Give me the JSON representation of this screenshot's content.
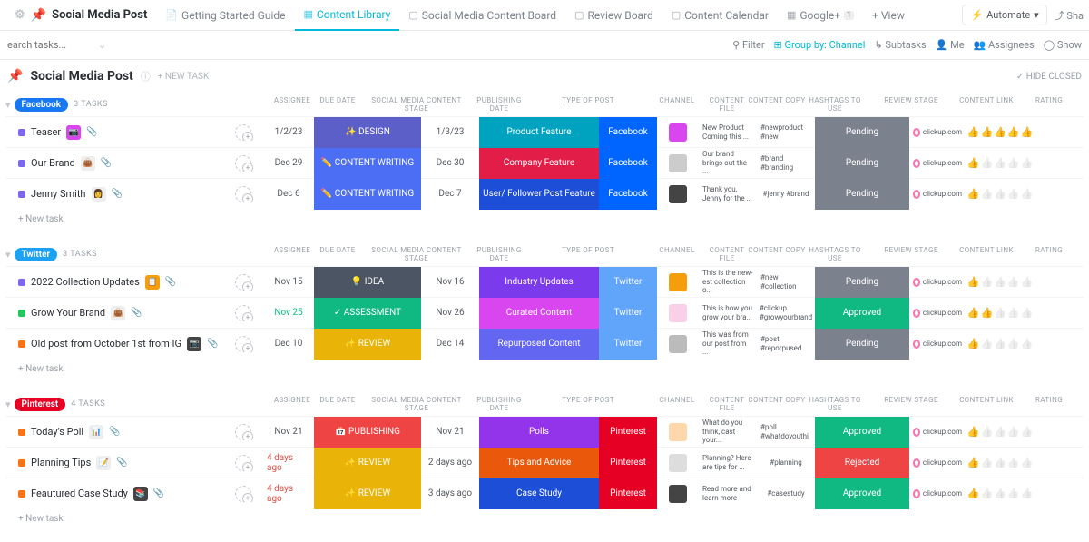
{
  "header": {
    "title": "Social Media Post",
    "views": [
      {
        "label": "Getting Started Guide",
        "icon": "📄"
      },
      {
        "label": "Content Library",
        "icon": "▦",
        "active": true
      },
      {
        "label": "Social Media Content Board",
        "icon": "▢"
      },
      {
        "label": "Review Board",
        "icon": "▢"
      },
      {
        "label": "Content Calendar",
        "icon": "▢"
      },
      {
        "label": "Google+",
        "icon": "▦",
        "badge": "1"
      }
    ],
    "add_view": "+ View",
    "automate": "Automate",
    "share": "Sha"
  },
  "toolbar": {
    "search_placeholder": "earch tasks...",
    "filter": "Filter",
    "group": "Group by: Channel",
    "subtasks": "Subtasks",
    "me": "Me",
    "assignees": "Assignees",
    "show": "Show"
  },
  "subheader": {
    "title": "Social Media Post",
    "newtask": "+ NEW TASK",
    "hide": "✓ HIDE CLOSED"
  },
  "columns": [
    "ASSIGNEE",
    "DUE DATE",
    "SOCIAL MEDIA CONTENT STAGE",
    "PUBLISHING DATE",
    "TYPE OF POST",
    "CHANNEL",
    "CONTENT FILE",
    "CONTENT COPY",
    "HASHTAGS TO USE",
    "REVIEW STAGE",
    "CONTENT LINK",
    "RATING"
  ],
  "newtask_row": "+ New task",
  "groups": [
    {
      "name": "Facebook",
      "count": "3 TASKS",
      "chip": "#1877f2",
      "bullet": "#7b68ee",
      "tasks": [
        {
          "title": "Teaser",
          "badge_bg": "#d946ef",
          "badge": "📷",
          "due": "1/2/23",
          "stage": "✨ DESIGN",
          "stage_bg": "#5b5fc7",
          "pub": "1/3/23",
          "type": "Product Feature",
          "type_bg": "#00a3bf",
          "chan": "Facebook",
          "chan_bg": "#0065ff",
          "file_bg": "#d946ef",
          "copy": "New Product Coming this ...",
          "hash": "#newproduct #new",
          "rev": "Pending",
          "rev_bg": "#7c828d",
          "link": "clickup.com",
          "rating": 5
        },
        {
          "title": "Our Brand",
          "badge_bg": "#eee",
          "badge": "👜",
          "due": "Dec 29",
          "stage": "✏️ CONTENT WRITING",
          "stage_bg": "#4c6ef5",
          "pub": "Dec 30",
          "type": "Company Feature",
          "type_bg": "#e11d48",
          "chan": "Facebook",
          "chan_bg": "#0065ff",
          "file_bg": "#ccc",
          "copy": "Our brand brings out the ...",
          "hash": "#brand #branding",
          "rev": "Pending",
          "rev_bg": "#7c828d",
          "link": "clickup.com",
          "rating": 1
        },
        {
          "title": "Jenny Smith",
          "badge_bg": "#eee",
          "badge": "👩",
          "due": "Dec 6",
          "stage": "✏️ CONTENT WRITING",
          "stage_bg": "#4c6ef5",
          "pub": "Dec 7",
          "type": "User/ Follower Post Feature",
          "type_bg": "#1d4ed8",
          "chan": "Facebook",
          "chan_bg": "#0065ff",
          "file_bg": "#444",
          "copy": "Thank you, Jenny for the ...",
          "hash": "#jenny #brand",
          "rev": "Pending",
          "rev_bg": "#7c828d",
          "link": "clickup.com",
          "rating": 1
        }
      ]
    },
    {
      "name": "Twitter",
      "count": "3 TASKS",
      "chip": "#1da1f2",
      "tasks": [
        {
          "title": "2022 Collection Updates",
          "bullet": "#7b68ee",
          "badge_bg": "#f59e0b",
          "badge": "📋",
          "due": "Nov 15",
          "stage": "💡 IDEA",
          "stage_bg": "#4b5563",
          "pub": "Nov 16",
          "type": "Industry Updates",
          "type_bg": "#7c3aed",
          "chan": "Twitter",
          "chan_bg": "#60a5fa",
          "file_bg": "#f59e0b",
          "copy": "This is the new-est collection o...",
          "hash": "#new #collection",
          "rev": "Pending",
          "rev_bg": "#7c828d",
          "link": "clickup.com",
          "rating": 1
        },
        {
          "title": "Grow Your Brand",
          "bullet": "#22c55e",
          "badge_bg": "#eee",
          "badge": "👜",
          "due": "Nov 25",
          "due_accent": true,
          "stage": "✓ ASSESSMENT",
          "stage_bg": "#10b981",
          "pub": "Nov 26",
          "type": "Curated Content",
          "type_bg": "#d946ef",
          "chan": "Twitter",
          "chan_bg": "#60a5fa",
          "file_bg": "#fbcfe8",
          "copy": "This is how you grow your bra...",
          "hash": "#clickup #growyourbrand",
          "rev": "Approved",
          "rev_bg": "#10b981",
          "link": "clickup.com",
          "rating": 2
        },
        {
          "title": "Old post from October 1st from IG",
          "bullet": "#f97316",
          "badge_bg": "#444",
          "badge": "📷",
          "due": "Dec 10",
          "stage": "✨ REVIEW",
          "stage_bg": "#eab308",
          "pub": "Dec 14",
          "type": "Repurposed Content",
          "type_bg": "#6366f1",
          "chan": "Twitter",
          "chan_bg": "#60a5fa",
          "file_bg": "#bbb",
          "copy": "This was from our post from ...",
          "hash": "#post #reporpused",
          "rev": "Pending",
          "rev_bg": "#7c828d",
          "link": "clickup.com",
          "rating": 1
        }
      ]
    },
    {
      "name": "Pinterest",
      "count": "4 TASKS",
      "chip": "#e60023",
      "tasks": [
        {
          "title": "Today's Poll",
          "bullet": "#f97316",
          "badge_bg": "#eee",
          "badge": "📊",
          "due": "Nov 21",
          "stage": "📅 PUBLISHING",
          "stage_bg": "#ef4444",
          "pub": "Nov 21",
          "type": "Polls",
          "type_bg": "#9333ea",
          "chan": "Pinterest",
          "chan_bg": "#e60023",
          "file_bg": "#fed7aa",
          "copy": "What do you think, cast your...",
          "hash": "#poll #whatdoyouthi",
          "rev": "Approved",
          "rev_bg": "#10b981",
          "link": "clickup.com",
          "rating": 1
        },
        {
          "title": "Planning Tips",
          "bullet": "#f97316",
          "badge_bg": "#eee",
          "badge": "📝",
          "due": "4 days ago",
          "overdue": true,
          "stage": "✨ REVIEW",
          "stage_bg": "#eab308",
          "pub": "2 days ago",
          "type": "Tips and Advice",
          "type_bg": "#ea580c",
          "chan": "Pinterest",
          "chan_bg": "#e60023",
          "file_bg": "#ddd",
          "copy": "Planning? Here are tips for ...",
          "hash": "#planning",
          "rev": "Rejected",
          "rev_bg": "#ef4444",
          "link": "clickup.com",
          "rating": 1
        },
        {
          "title": "Feautured Case Study",
          "bullet": "#f97316",
          "badge_bg": "#444",
          "badge": "📚",
          "due": "4 days ago",
          "overdue": true,
          "stage": "✨ REVIEW",
          "stage_bg": "#eab308",
          "pub": "3 days ago",
          "type": "Case Study",
          "type_bg": "#1d4ed8",
          "chan": "Pinterest",
          "chan_bg": "#e60023",
          "file_bg": "#444",
          "copy": "Read more and learn more",
          "hash": "#casestudy",
          "rev": "Approved",
          "rev_bg": "#10b981",
          "link": "clickup.com",
          "rating": 1
        }
      ]
    }
  ]
}
